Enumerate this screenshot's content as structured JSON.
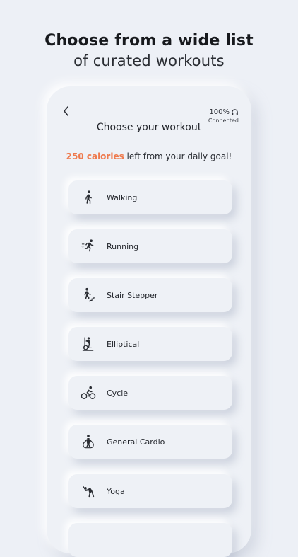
{
  "headline": {
    "line1": "Choose from a wide list",
    "line2": "of curated workouts"
  },
  "status": {
    "battery": "100%",
    "connection": "Connected"
  },
  "screen": {
    "title": "Choose your workout",
    "calories_highlight": "250 calories",
    "calories_rest": " left from your daily goal!"
  },
  "workouts": [
    {
      "label": "Walking",
      "icon": "walking-icon"
    },
    {
      "label": "Running",
      "icon": "running-icon"
    },
    {
      "label": "Stair Stepper",
      "icon": "stair-stepper-icon"
    },
    {
      "label": "Elliptical",
      "icon": "elliptical-icon"
    },
    {
      "label": "Cycle",
      "icon": "cycle-icon"
    },
    {
      "label": "General Cardio",
      "icon": "general-cardio-icon"
    },
    {
      "label": "Yoga",
      "icon": "yoga-icon"
    }
  ],
  "colors": {
    "background": "#edf0f6",
    "accent": "#ee7a4d",
    "text": "#23262c"
  }
}
